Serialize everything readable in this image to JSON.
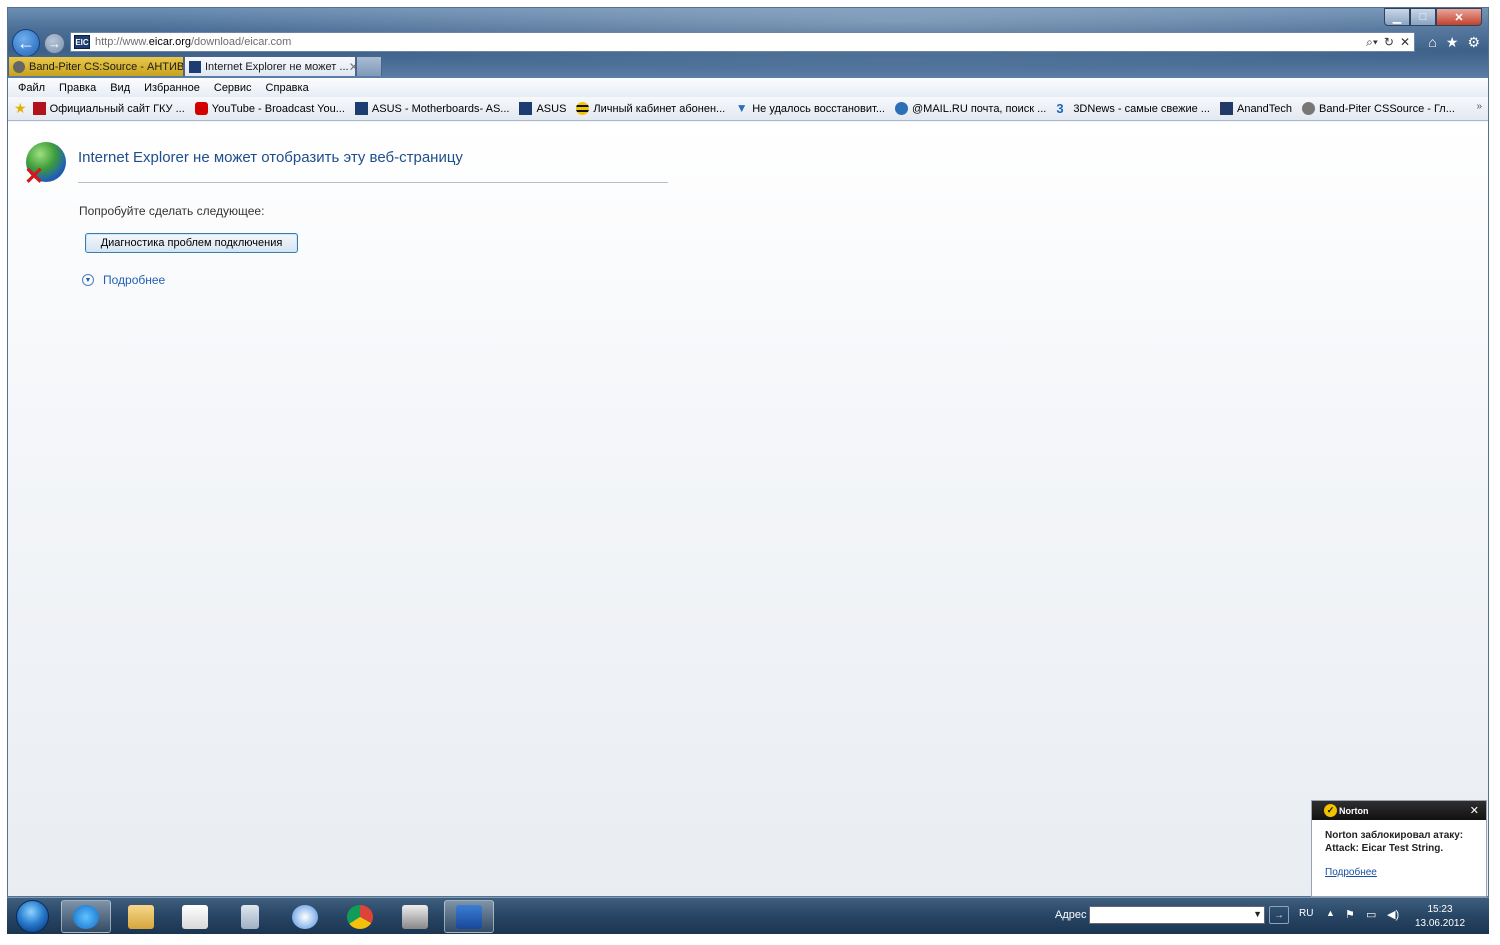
{
  "browser": {
    "url_prefix": "http://www.",
    "url_domain": "eicar.org",
    "url_path": "/download/eicar.com",
    "tabs": [
      {
        "label": "Band-Piter CS:Source - АНТИВ...",
        "active": false
      },
      {
        "label": "Internet Explorer не может ...",
        "active": true
      }
    ],
    "menu": [
      "Файл",
      "Правка",
      "Вид",
      "Избранное",
      "Сервис",
      "Справка"
    ],
    "favorites": [
      "Официальный сайт ГКУ ...",
      "YouTube - Broadcast You...",
      "ASUS - Motherboards- AS...",
      "ASUS",
      "Личный кабинет абонен...",
      "Не удалось восстановит...",
      "@MAIL.RU почта, поиск ...",
      "3DNews - самые свежие ...",
      "AnandTech",
      "Band-Piter CSSource - Гл..."
    ]
  },
  "error_page": {
    "title": "Internet Explorer не может отобразить эту веб-страницу",
    "try_text": "Попробуйте сделать следующее:",
    "diagnose_button": "Диагностика проблем подключения",
    "more_link": "Подробнее"
  },
  "norton": {
    "brand": "Norton",
    "message": "Norton заблокировал атаку: Attack: Eicar Test String.",
    "link": "Подробнее"
  },
  "taskbar": {
    "address_label": "Адрес",
    "language": "RU",
    "time": "15:23",
    "date": "13.06.2012"
  },
  "colors": {
    "link": "#1f5fb3",
    "title_text": "#1f4e8c",
    "norton_yellow": "#f2c100"
  }
}
